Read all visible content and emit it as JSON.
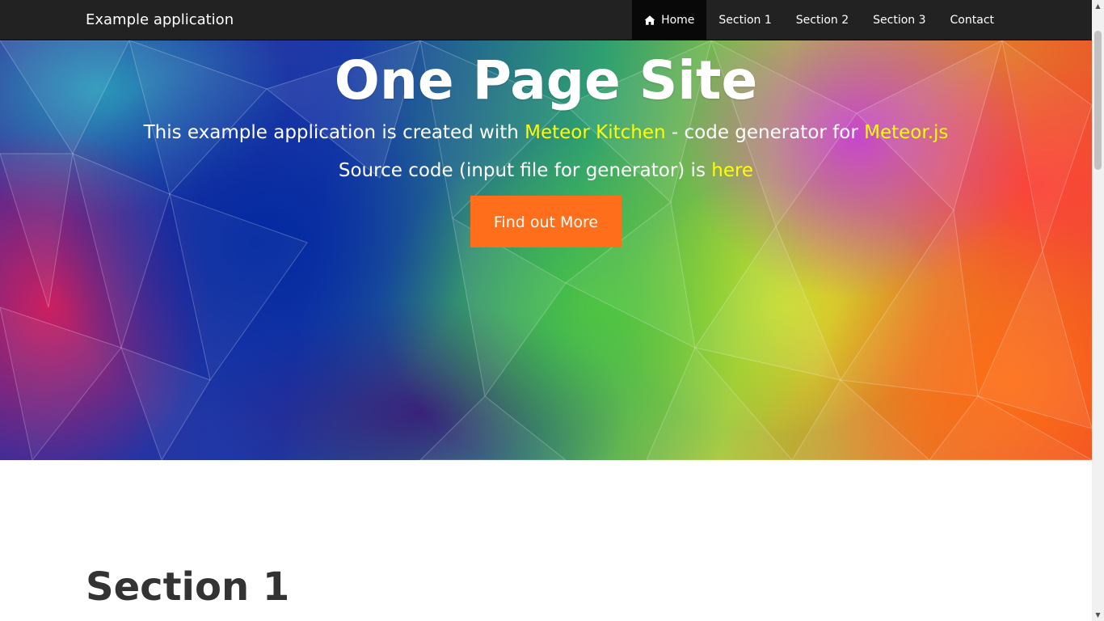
{
  "navbar": {
    "brand": "Example application",
    "items": [
      {
        "label": "Home",
        "icon": "home-icon",
        "active": true
      },
      {
        "label": "Section 1"
      },
      {
        "label": "Section 2"
      },
      {
        "label": "Section 3"
      },
      {
        "label": "Contact"
      }
    ]
  },
  "hero": {
    "title": "One Page Site",
    "line1": {
      "text_a": "This example application is created with ",
      "link_1": "Meteor Kitchen",
      "text_b": " - code generator for ",
      "link_2": "Meteor.js"
    },
    "line2": {
      "text_a": "Source code (input file for generator) is ",
      "link": "here"
    },
    "cta_label": "Find out More"
  },
  "section1": {
    "title": "Section 1"
  },
  "colors": {
    "navbar_bg": "#222222",
    "nav_active_bg": "#080808",
    "link_highlight": "#ffff00",
    "cta_bg": "#ff6e1a",
    "heading_text": "#333333"
  },
  "scrollbar": {
    "up_icon": "scroll-up-arrow-icon",
    "down_icon": "scroll-down-arrow-icon"
  }
}
